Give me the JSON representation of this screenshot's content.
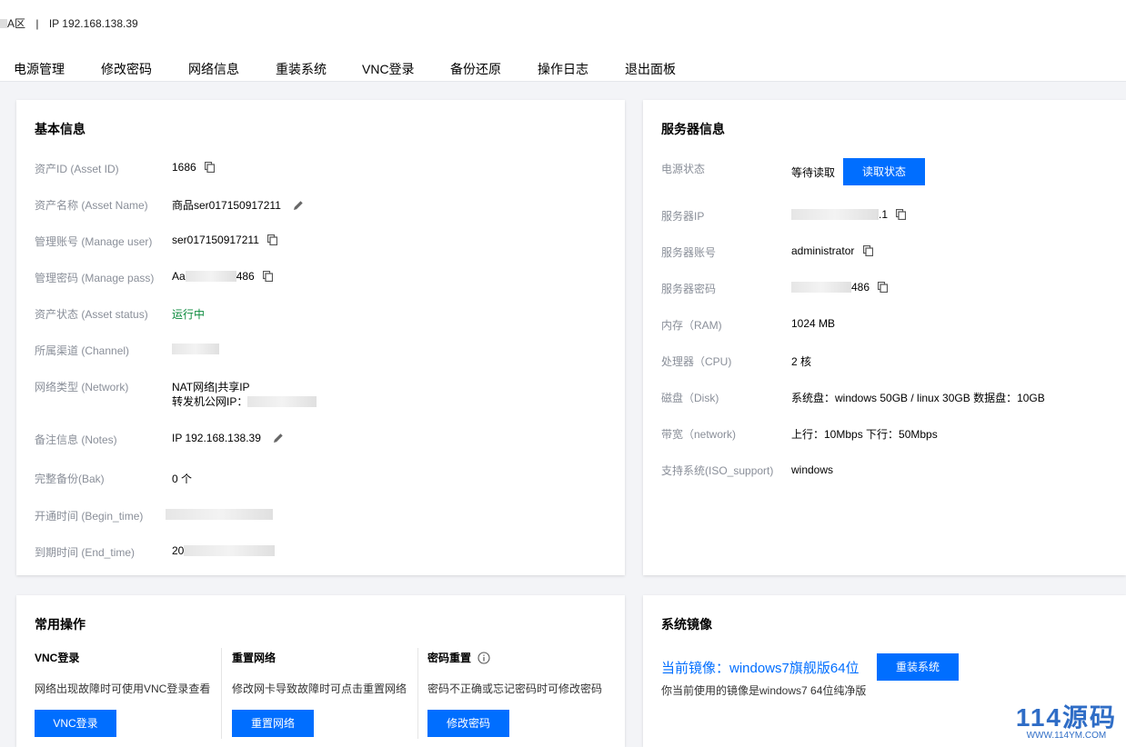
{
  "header": {
    "region_text": "A区",
    "separator": "|",
    "ip_text": "IP 192.168.138.39"
  },
  "nav": [
    {
      "label": "电源管理"
    },
    {
      "label": "修改密码"
    },
    {
      "label": "网络信息"
    },
    {
      "label": "重装系统"
    },
    {
      "label": "VNC登录"
    },
    {
      "label": "备份还原"
    },
    {
      "label": "操作日志"
    },
    {
      "label": "退出面板"
    }
  ],
  "basic_info": {
    "title": "基本信息",
    "rows": [
      {
        "label": "资产ID (Asset ID)",
        "value": "1686"
      },
      {
        "label": "资产名称 (Asset Name)",
        "value": "商品ser017150917211"
      },
      {
        "label": "管理账号 (Manage user)",
        "value": "ser017150917211"
      },
      {
        "label": "管理密码 (Manage pass)",
        "value": "Aa",
        "value_tail": "486"
      },
      {
        "label": "资产状态 (Asset status)",
        "value": "运行中"
      },
      {
        "label": "所属渠道 (Channel)",
        "value": ""
      },
      {
        "label": "网络类型 (Network)",
        "value": "NAT网络|共享IP",
        "value2": "转发机公网IP："
      },
      {
        "label": "备注信息 (Notes)",
        "value": "IP 192.168.138.39"
      },
      {
        "label": "完整备份(Bak)",
        "value": "0 个"
      },
      {
        "label": "开通时间 (Begin_time)",
        "value": ""
      },
      {
        "label": "到期时间 (End_time)",
        "value": "20"
      }
    ]
  },
  "server_info": {
    "title": "服务器信息",
    "power_label": "电源状态",
    "power_value": "等待读取",
    "read_button": "读取状态",
    "rows": [
      {
        "label": "服务器IP",
        "value": ".1"
      },
      {
        "label": "服务器账号",
        "value": "administrator"
      },
      {
        "label": "服务器密码",
        "value": "486"
      },
      {
        "label": "内存（RAM)",
        "value": "1024 MB"
      },
      {
        "label": "处理器（CPU)",
        "value": "2 核"
      },
      {
        "label": "磁盘（Disk)",
        "value": "系统盘：windows 50GB / linux 30GB 数据盘：10GB"
      },
      {
        "label": "带宽（network)",
        "value": "上行：10Mbps 下行：50Mbps"
      },
      {
        "label": "支持系统(ISO_support)",
        "value": "windows"
      }
    ]
  },
  "common_ops": {
    "title": "常用操作",
    "ops": [
      {
        "title": "VNC登录",
        "desc": "网络出现故障时可使用VNC登录查看",
        "button": "VNC登录"
      },
      {
        "title": "重置网络",
        "desc": "修改网卡导致故障时可点击重置网络",
        "button": "重置网络"
      },
      {
        "title": "密码重置",
        "desc": "密码不正确或忘记密码时可修改密码",
        "button": "修改密码"
      }
    ]
  },
  "system_image": {
    "title": "系统镜像",
    "current": "当前镜像：windows7旗舰版64位",
    "reinstall_button": "重装系统",
    "desc": "你当前使用的镜像是windows7 64位纯净版"
  },
  "watermark": {
    "big": "114源码",
    "small": "WWW.114YM.COM"
  },
  "colors": {
    "accent": "#006eff",
    "running": "#0a8a3c",
    "label": "#8a8f99"
  }
}
